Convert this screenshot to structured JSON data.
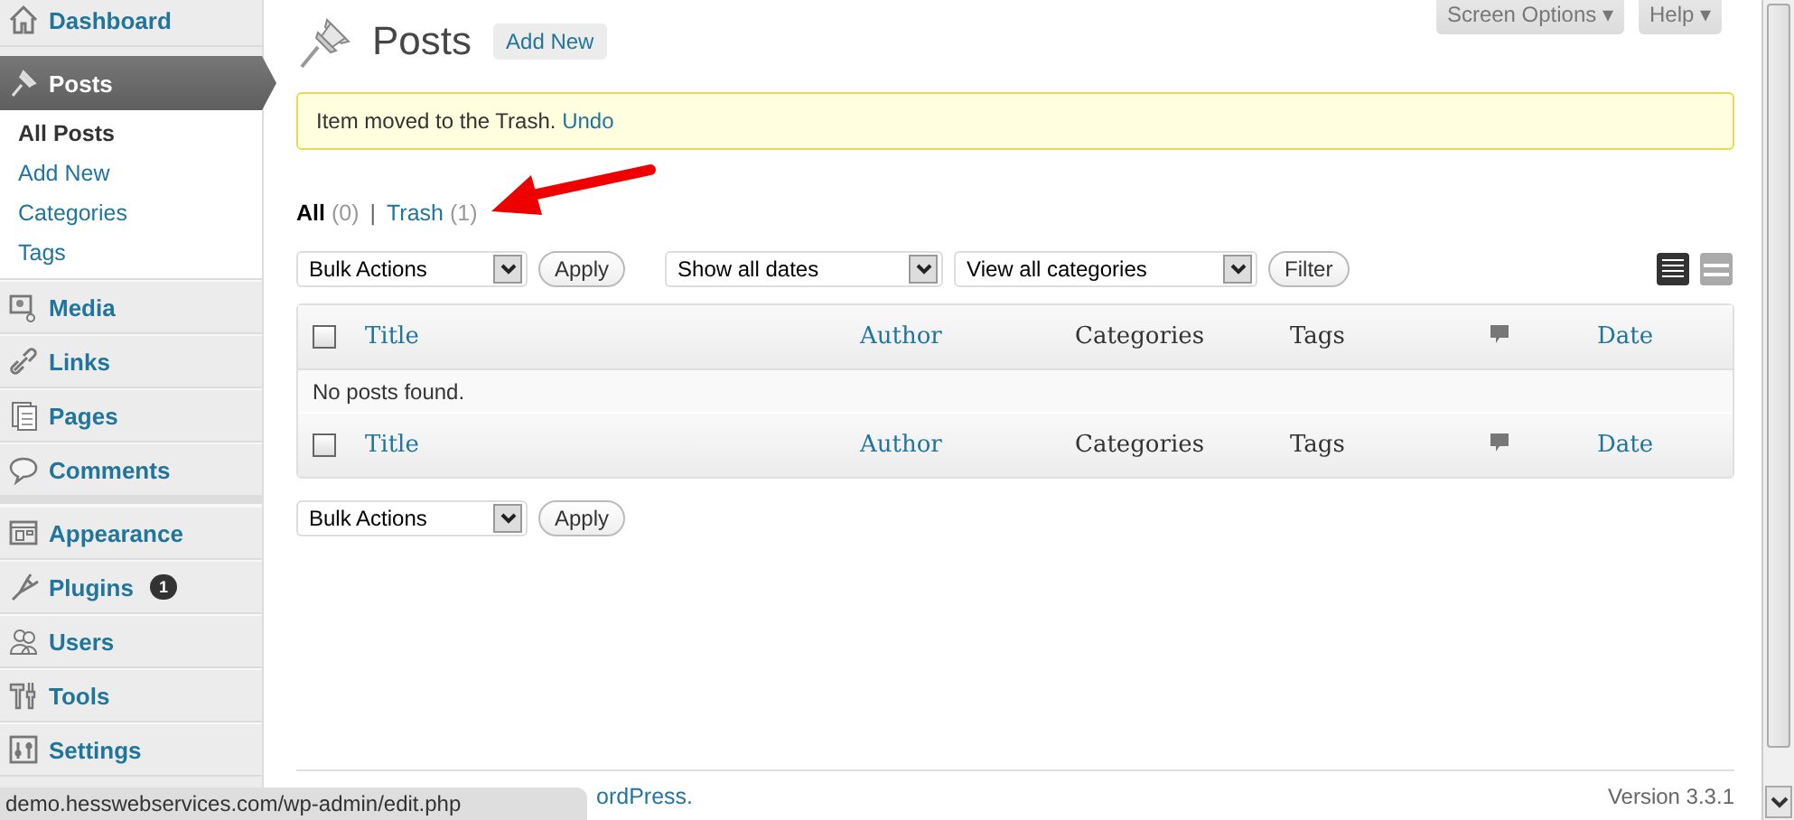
{
  "sidebar": {
    "items": [
      {
        "label": "Dashboard",
        "selected": false
      },
      {
        "label": "Posts",
        "selected": true,
        "children": [
          {
            "label": "All Posts",
            "selected": true
          },
          {
            "label": "Add New",
            "selected": false
          },
          {
            "label": "Categories",
            "selected": false
          },
          {
            "label": "Tags",
            "selected": false
          }
        ]
      },
      {
        "label": "Media",
        "selected": false
      },
      {
        "label": "Links",
        "selected": false
      },
      {
        "label": "Pages",
        "selected": false
      },
      {
        "label": "Comments",
        "selected": false,
        "separator_after": true
      },
      {
        "label": "Appearance",
        "selected": false
      },
      {
        "label": "Plugins",
        "selected": false,
        "badge": "1"
      },
      {
        "label": "Users",
        "selected": false
      },
      {
        "label": "Tools",
        "selected": false
      },
      {
        "label": "Settings",
        "selected": false
      }
    ]
  },
  "header_tabs": [
    "Screen Options ▾",
    "Help ▾"
  ],
  "page": {
    "title": "Posts",
    "add_new": "Add New"
  },
  "notice": {
    "text": "Item moved to the Trash.",
    "link": "Undo"
  },
  "views_separator": "|",
  "views": [
    {
      "label": "All",
      "count": "(0)",
      "selected": true
    },
    {
      "label": "Trash",
      "count": "(1)",
      "selected": false
    }
  ],
  "top_actions": {
    "bulk": "Bulk Actions",
    "apply": "Apply",
    "dates": "Show all dates",
    "categories": "View all categories",
    "filter": "Filter"
  },
  "view_modes": [
    {
      "kind": "list",
      "selected": true
    },
    {
      "kind": "excerpt",
      "selected": false
    }
  ],
  "table": {
    "header": [
      {
        "kind": "checkbox",
        "checked": false
      },
      {
        "kind": "sortable",
        "label": "Title"
      },
      {
        "kind": "sortable",
        "label": "Author"
      },
      {
        "kind": "plain",
        "label": "Categories"
      },
      {
        "kind": "plain",
        "label": "Tags"
      },
      {
        "kind": "comments"
      },
      {
        "kind": "sortable",
        "label": "Date"
      }
    ],
    "empty": "No posts found.",
    "footer": [
      {
        "kind": "checkbox",
        "checked": false
      },
      {
        "kind": "sortable",
        "label": "Title"
      },
      {
        "kind": "sortable",
        "label": "Author"
      },
      {
        "kind": "plain",
        "label": "Categories"
      },
      {
        "kind": "plain",
        "label": "Tags"
      },
      {
        "kind": "comments"
      },
      {
        "kind": "sortable",
        "label": "Date"
      }
    ]
  },
  "bottom_actions": {
    "bulk": "Bulk Actions",
    "apply": "Apply"
  },
  "footer": {
    "text": "ordPress.",
    "version": "Version 3.3.1"
  },
  "status_bar": {
    "url": "demo.hesswebservices.com/wp-admin/edit.php"
  }
}
